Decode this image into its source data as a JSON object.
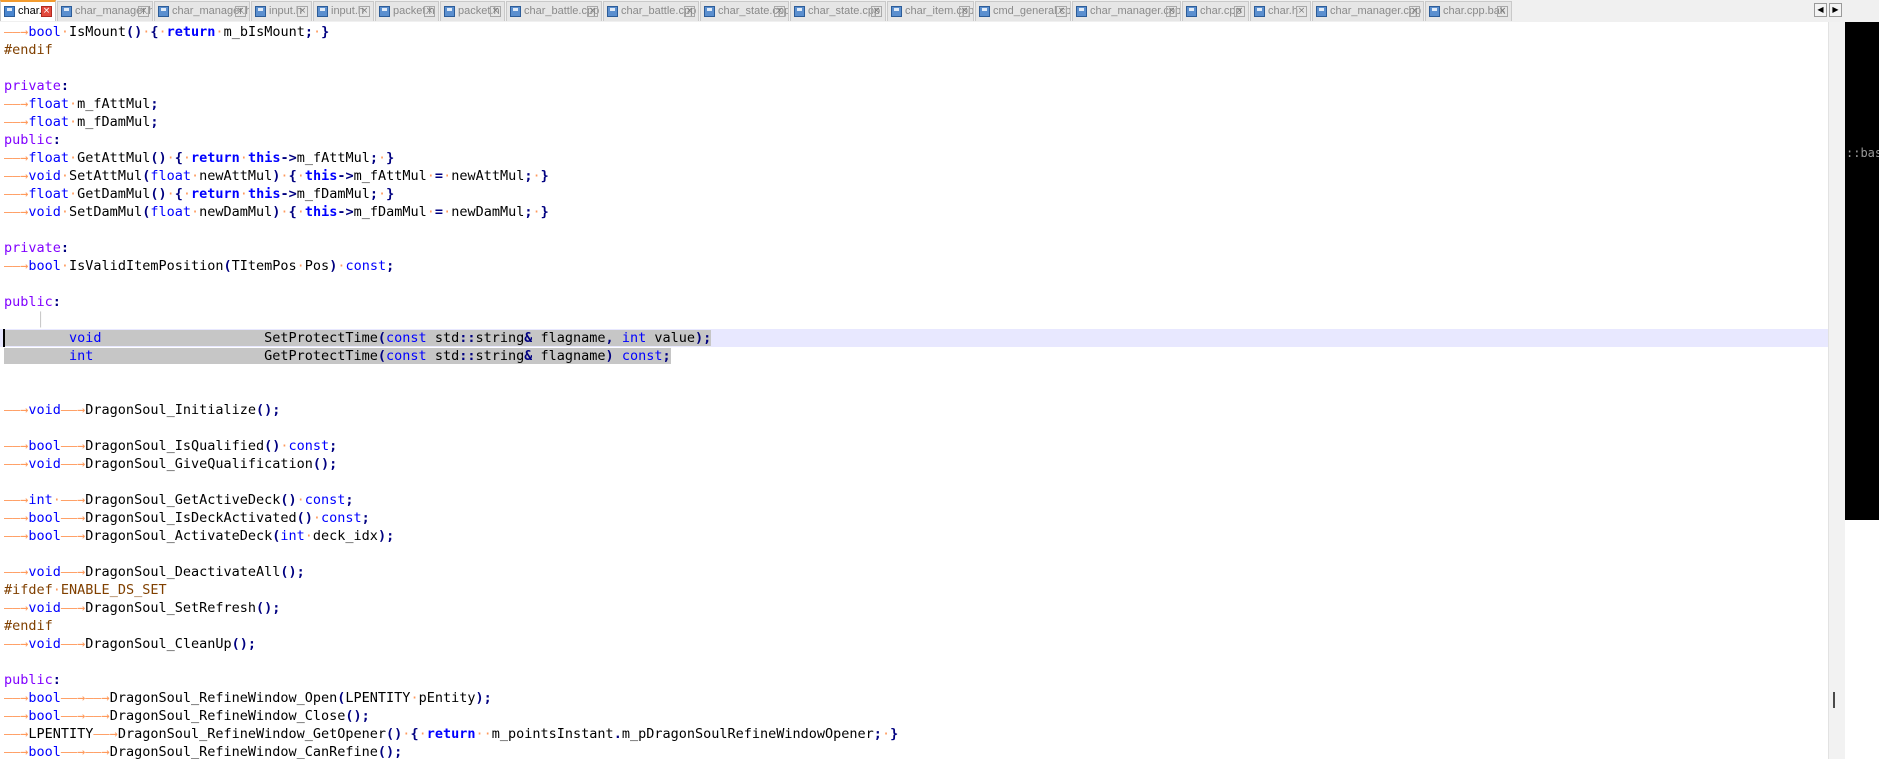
{
  "tabs": [
    {
      "label": "char.h",
      "active": true
    },
    {
      "label": "char_manager.h"
    },
    {
      "label": "char_manager.h"
    },
    {
      "label": "input.h"
    },
    {
      "label": "input.h"
    },
    {
      "label": "packet.h"
    },
    {
      "label": "packet.h"
    },
    {
      "label": "char_battle.cpp"
    },
    {
      "label": "char_battle.cpp"
    },
    {
      "label": "char_state.cpp"
    },
    {
      "label": "char_state.cpp"
    },
    {
      "label": "char_item.cpp"
    },
    {
      "label": "cmd_general.cpp"
    },
    {
      "label": "char_manager.cpp"
    },
    {
      "label": "char.cpp"
    },
    {
      "label": "char.h"
    },
    {
      "label": "char_manager.cpp"
    },
    {
      "label": "char.cpp.bak"
    }
  ],
  "tab_scroll": {
    "left": "◀",
    "right": "▶"
  },
  "side_panel_text": "::bas",
  "colors": {
    "keyword": "#0000ff",
    "type": "#8000ff",
    "preprocessor": "#804000",
    "whitespace_arrow": "#ff9a5c",
    "selection": "#c6c6c6",
    "current_line": "#e8e8ff",
    "active_tab_accent": "#f39b2e"
  },
  "code_lines": [
    [
      [
        "ws",
        "——→"
      ],
      [
        "k",
        "bool"
      ],
      [
        "ws",
        "·"
      ],
      [
        "t",
        "IsMount"
      ],
      [
        "o",
        "()"
      ],
      [
        "ws",
        "·"
      ],
      [
        "o",
        "{"
      ],
      [
        "ws",
        "·"
      ],
      [
        "kb",
        "return"
      ],
      [
        "ws",
        "·"
      ],
      [
        "t",
        "m_bIsMount"
      ],
      [
        "o",
        ";"
      ],
      [
        "ws",
        "·"
      ],
      [
        "o",
        "}"
      ]
    ],
    [
      [
        "pp",
        "#endif"
      ]
    ],
    [],
    [
      [
        "p",
        "private"
      ],
      [
        "o",
        ":"
      ]
    ],
    [
      [
        "ws",
        "——→"
      ],
      [
        "k",
        "float"
      ],
      [
        "ws",
        "·"
      ],
      [
        "t",
        "m_fAttMul"
      ],
      [
        "o",
        ";"
      ]
    ],
    [
      [
        "ws",
        "——→"
      ],
      [
        "k",
        "float"
      ],
      [
        "ws",
        "·"
      ],
      [
        "t",
        "m_fDamMul"
      ],
      [
        "o",
        ";"
      ]
    ],
    [
      [
        "p",
        "public"
      ],
      [
        "o",
        ":"
      ]
    ],
    [
      [
        "ws",
        "——→"
      ],
      [
        "k",
        "float"
      ],
      [
        "ws",
        "·"
      ],
      [
        "t",
        "GetAttMul"
      ],
      [
        "o",
        "()"
      ],
      [
        "ws",
        "·"
      ],
      [
        "o",
        "{"
      ],
      [
        "ws",
        "·"
      ],
      [
        "kb",
        "return"
      ],
      [
        "ws",
        "·"
      ],
      [
        "kb",
        "this"
      ],
      [
        "o",
        "->"
      ],
      [
        "t",
        "m_fAttMul"
      ],
      [
        "o",
        ";"
      ],
      [
        "ws",
        "·"
      ],
      [
        "o",
        "}"
      ]
    ],
    [
      [
        "ws",
        "——→"
      ],
      [
        "k",
        "void"
      ],
      [
        "ws",
        "·"
      ],
      [
        "t",
        "SetAttMul"
      ],
      [
        "o",
        "("
      ],
      [
        "k",
        "float"
      ],
      [
        "ws",
        "·"
      ],
      [
        "t",
        "newAttMul"
      ],
      [
        "o",
        ")"
      ],
      [
        "ws",
        "·"
      ],
      [
        "o",
        "{"
      ],
      [
        "ws",
        "·"
      ],
      [
        "kb",
        "this"
      ],
      [
        "o",
        "->"
      ],
      [
        "t",
        "m_fAttMul"
      ],
      [
        "ws",
        "·"
      ],
      [
        "o",
        "="
      ],
      [
        "ws",
        "·"
      ],
      [
        "t",
        "newAttMul"
      ],
      [
        "o",
        ";"
      ],
      [
        "ws",
        "·"
      ],
      [
        "o",
        "}"
      ]
    ],
    [
      [
        "ws",
        "——→"
      ],
      [
        "k",
        "float"
      ],
      [
        "ws",
        "·"
      ],
      [
        "t",
        "GetDamMul"
      ],
      [
        "o",
        "()"
      ],
      [
        "ws",
        "·"
      ],
      [
        "o",
        "{"
      ],
      [
        "ws",
        "·"
      ],
      [
        "kb",
        "return"
      ],
      [
        "ws",
        "·"
      ],
      [
        "kb",
        "this"
      ],
      [
        "o",
        "->"
      ],
      [
        "t",
        "m_fDamMul"
      ],
      [
        "o",
        ";"
      ],
      [
        "ws",
        "·"
      ],
      [
        "o",
        "}"
      ]
    ],
    [
      [
        "ws",
        "——→"
      ],
      [
        "k",
        "void"
      ],
      [
        "ws",
        "·"
      ],
      [
        "t",
        "SetDamMul"
      ],
      [
        "o",
        "("
      ],
      [
        "k",
        "float"
      ],
      [
        "ws",
        "·"
      ],
      [
        "t",
        "newDamMul"
      ],
      [
        "o",
        ")"
      ],
      [
        "ws",
        "·"
      ],
      [
        "o",
        "{"
      ],
      [
        "ws",
        "·"
      ],
      [
        "kb",
        "this"
      ],
      [
        "o",
        "->"
      ],
      [
        "t",
        "m_fDamMul"
      ],
      [
        "ws",
        "·"
      ],
      [
        "o",
        "="
      ],
      [
        "ws",
        "·"
      ],
      [
        "t",
        "newDamMul"
      ],
      [
        "o",
        ";"
      ],
      [
        "ws",
        "·"
      ],
      [
        "o",
        "}"
      ]
    ],
    [],
    [
      [
        "p",
        "private"
      ],
      [
        "o",
        ":"
      ]
    ],
    [
      [
        "ws",
        "——→"
      ],
      [
        "k",
        "bool"
      ],
      [
        "ws",
        "·"
      ],
      [
        "t",
        "IsValidItemPosition"
      ],
      [
        "o",
        "("
      ],
      [
        "t",
        "TItemPos"
      ],
      [
        "ws",
        "·"
      ],
      [
        "t",
        "Pos"
      ],
      [
        "o",
        ")"
      ],
      [
        "ws",
        "·"
      ],
      [
        "k",
        "const"
      ],
      [
        "o",
        ";"
      ]
    ],
    [],
    [
      [
        "p",
        "public"
      ],
      [
        "o",
        ":"
      ]
    ],
    [
      [
        "ws2",
        "    │"
      ]
    ],
    [
      [
        "ws2",
        "        "
      ],
      [
        "k",
        "void"
      ],
      [
        "ws2",
        "                    "
      ],
      [
        "t",
        "SetProtectTime"
      ],
      [
        "o",
        "("
      ],
      [
        "k",
        "const"
      ],
      [
        "t",
        " std"
      ],
      [
        "o",
        "::"
      ],
      [
        "t",
        "string"
      ],
      [
        "o",
        "&"
      ],
      [
        "t",
        " flagname"
      ],
      [
        "o",
        ","
      ],
      [
        "t",
        " "
      ],
      [
        "k",
        "int"
      ],
      [
        "t",
        " value"
      ],
      [
        "o",
        ");"
      ]
    ],
    [
      [
        "ws2",
        "        "
      ],
      [
        "k",
        "int"
      ],
      [
        "ws2",
        "                     "
      ],
      [
        "t",
        "GetProtectTime"
      ],
      [
        "o",
        "("
      ],
      [
        "k",
        "const"
      ],
      [
        "t",
        " std"
      ],
      [
        "o",
        "::"
      ],
      [
        "t",
        "string"
      ],
      [
        "o",
        "&"
      ],
      [
        "t",
        " flagname"
      ],
      [
        "o",
        ")"
      ],
      [
        "t",
        " "
      ],
      [
        "k",
        "const"
      ],
      [
        "o",
        ";"
      ]
    ],
    [],
    [],
    [
      [
        "ws",
        "——→"
      ],
      [
        "k",
        "void"
      ],
      [
        "ws",
        "——→"
      ],
      [
        "t",
        "DragonSoul_Initialize"
      ],
      [
        "o",
        "();"
      ]
    ],
    [],
    [
      [
        "ws",
        "——→"
      ],
      [
        "k",
        "bool"
      ],
      [
        "ws",
        "——→"
      ],
      [
        "t",
        "DragonSoul_IsQualified"
      ],
      [
        "o",
        "()"
      ],
      [
        "ws",
        "·"
      ],
      [
        "k",
        "const"
      ],
      [
        "o",
        ";"
      ]
    ],
    [
      [
        "ws",
        "——→"
      ],
      [
        "k",
        "void"
      ],
      [
        "ws",
        "——→"
      ],
      [
        "t",
        "DragonSoul_GiveQualification"
      ],
      [
        "o",
        "();"
      ]
    ],
    [],
    [
      [
        "ws",
        "——→"
      ],
      [
        "k",
        "int"
      ],
      [
        "ws",
        "·——→"
      ],
      [
        "t",
        "DragonSoul_GetActiveDeck"
      ],
      [
        "o",
        "()"
      ],
      [
        "ws",
        "·"
      ],
      [
        "k",
        "const"
      ],
      [
        "o",
        ";"
      ]
    ],
    [
      [
        "ws",
        "——→"
      ],
      [
        "k",
        "bool"
      ],
      [
        "ws",
        "——→"
      ],
      [
        "t",
        "DragonSoul_IsDeckActivated"
      ],
      [
        "o",
        "()"
      ],
      [
        "ws",
        "·"
      ],
      [
        "k",
        "const"
      ],
      [
        "o",
        ";"
      ]
    ],
    [
      [
        "ws",
        "——→"
      ],
      [
        "k",
        "bool"
      ],
      [
        "ws",
        "——→"
      ],
      [
        "t",
        "DragonSoul_ActivateDeck"
      ],
      [
        "o",
        "("
      ],
      [
        "k",
        "int"
      ],
      [
        "ws",
        "·"
      ],
      [
        "t",
        "deck_idx"
      ],
      [
        "o",
        ");"
      ]
    ],
    [],
    [
      [
        "ws",
        "——→"
      ],
      [
        "k",
        "void"
      ],
      [
        "ws",
        "——→"
      ],
      [
        "t",
        "DragonSoul_DeactivateAll"
      ],
      [
        "o",
        "();"
      ]
    ],
    [
      [
        "pp",
        "#ifdef"
      ],
      [
        "ws",
        "·"
      ],
      [
        "pp",
        "ENABLE_DS_SET"
      ]
    ],
    [
      [
        "ws",
        "——→"
      ],
      [
        "k",
        "void"
      ],
      [
        "ws",
        "——→"
      ],
      [
        "t",
        "DragonSoul_SetRefresh"
      ],
      [
        "o",
        "();"
      ]
    ],
    [
      [
        "pp",
        "#endif"
      ]
    ],
    [
      [
        "ws",
        "——→"
      ],
      [
        "k",
        "void"
      ],
      [
        "ws",
        "——→"
      ],
      [
        "t",
        "DragonSoul_CleanUp"
      ],
      [
        "o",
        "();"
      ]
    ],
    [],
    [
      [
        "p",
        "public"
      ],
      [
        "o",
        ":"
      ]
    ],
    [
      [
        "ws",
        "——→"
      ],
      [
        "k",
        "bool"
      ],
      [
        "ws",
        "——→"
      ],
      [
        "ws",
        "——→"
      ],
      [
        "t",
        "DragonSoul_RefineWindow_Open"
      ],
      [
        "o",
        "("
      ],
      [
        "t",
        "LPENTITY"
      ],
      [
        "ws",
        "·"
      ],
      [
        "t",
        "pEntity"
      ],
      [
        "o",
        ");"
      ]
    ],
    [
      [
        "ws",
        "——→"
      ],
      [
        "k",
        "bool"
      ],
      [
        "ws",
        "——→"
      ],
      [
        "ws",
        "——→"
      ],
      [
        "t",
        "DragonSoul_RefineWindow_Close"
      ],
      [
        "o",
        "();"
      ]
    ],
    [
      [
        "ws",
        "——→"
      ],
      [
        "t",
        "LPENTITY"
      ],
      [
        "ws",
        "——→"
      ],
      [
        "t",
        "DragonSoul_RefineWindow_GetOpener"
      ],
      [
        "o",
        "()"
      ],
      [
        "ws",
        "·"
      ],
      [
        "o",
        "{"
      ],
      [
        "ws",
        "·"
      ],
      [
        "kb",
        "return"
      ],
      [
        "ws",
        "··"
      ],
      [
        "t",
        "m_pointsInstant"
      ],
      [
        "o",
        "."
      ],
      [
        "t",
        "m_pDragonSoulRefineWindowOpener"
      ],
      [
        "o",
        ";"
      ],
      [
        "ws",
        "·"
      ],
      [
        "o",
        "}"
      ]
    ],
    [
      [
        "ws",
        "——→"
      ],
      [
        "k",
        "bool"
      ],
      [
        "ws",
        "——→"
      ],
      [
        "ws",
        "——→"
      ],
      [
        "t",
        "DragonSoul_RefineWindow_CanRefine"
      ],
      [
        "o",
        "();"
      ]
    ]
  ]
}
